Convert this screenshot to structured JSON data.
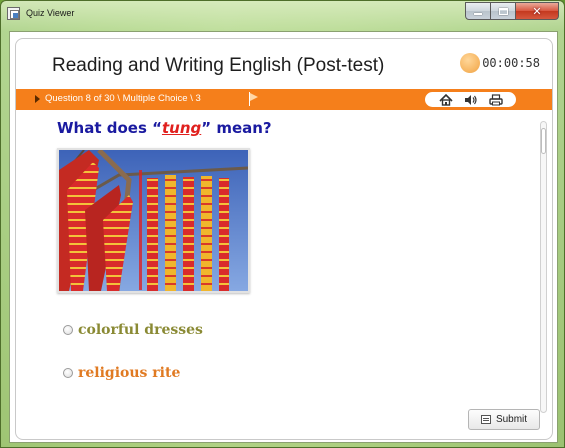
{
  "window": {
    "title": "Quiz Viewer"
  },
  "quiz": {
    "title": "Reading and Writing English (Post-test)",
    "timer": "00:00:58",
    "question_info": "Question 8 of 30 \\ Multiple Choice \\ 3",
    "question_prefix": "What does “",
    "question_word": "tung",
    "question_suffix": "” mean?",
    "options": [
      {
        "label": "colorful dresses",
        "color": "#8a8a34"
      },
      {
        "label": "religious rite",
        "color": "#e07a22"
      }
    ],
    "submit_label": "Submit"
  },
  "colors": {
    "accent_bar": "#f57f1b",
    "question_text": "#1a1aa0",
    "highlight_word": "#e0201e"
  },
  "icons": {
    "app": "quiz-viewer-icon",
    "flag": "flag-icon",
    "tools": [
      "home-icon",
      "speaker-icon",
      "printer-icon"
    ],
    "submit": "submit-icon"
  }
}
